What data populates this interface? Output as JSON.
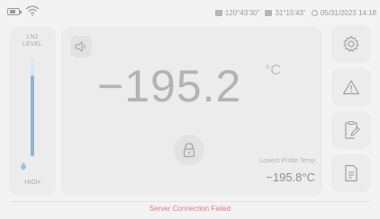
{
  "status_bar": {
    "longitude": "120°43'30\"",
    "latitude": "31°15'43\"",
    "datetime": "05/31/2023 14:18",
    "icons": [
      "battery-icon",
      "wifi-icon",
      "gps-icon",
      "clock-icon"
    ]
  },
  "ln2_panel": {
    "label": "LN2\nLEVEL",
    "level_text": "HIGH",
    "level_fraction": 0.82,
    "fill_color": "#8eb3d6"
  },
  "main_display": {
    "temperature": "−195.2",
    "unit": "°C",
    "probe_label": "Lowest Probe Temp",
    "probe_value": "−195.8°C"
  },
  "side_buttons": [
    {
      "icon": "gear-icon"
    },
    {
      "icon": "alert-icon"
    },
    {
      "icon": "clipboard-edit-icon"
    },
    {
      "icon": "document-icon"
    }
  ],
  "footer": {
    "message": "Server Connection Failed",
    "message_color": "#e07c7c"
  }
}
